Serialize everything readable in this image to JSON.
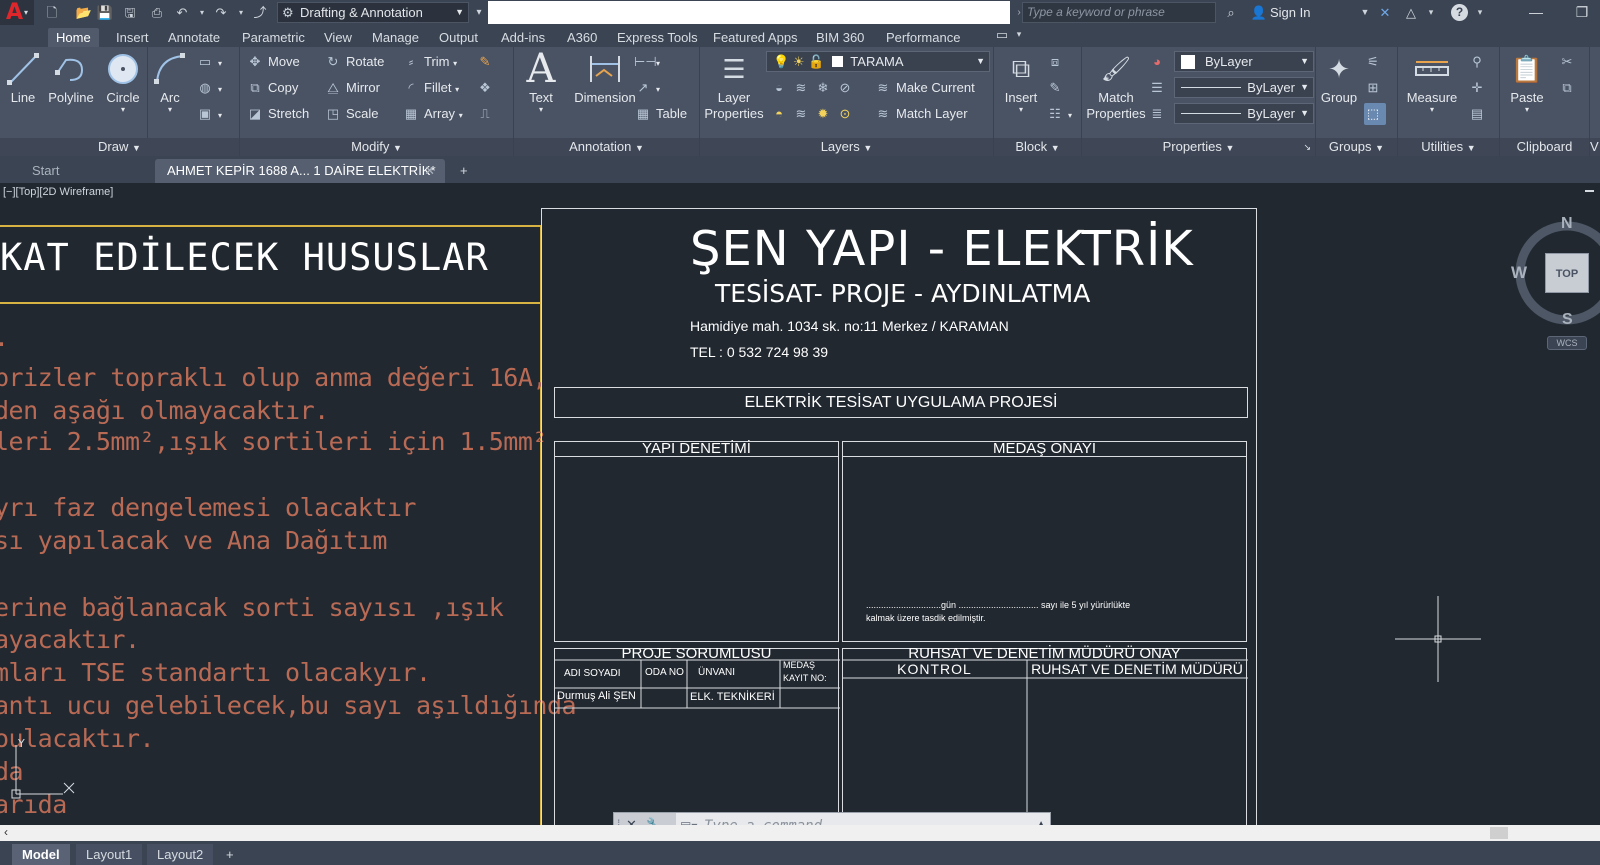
{
  "titlebar": {
    "workspace": "Drafting & Annotation",
    "search_placeholder": "Type a keyword or phrase",
    "sign_in": "Sign In"
  },
  "ribbon_tabs": [
    "Home",
    "Insert",
    "Annotate",
    "Parametric",
    "View",
    "Manage",
    "Output",
    "Add-ins",
    "A360",
    "Express Tools",
    "Featured Apps",
    "BIM 360",
    "Performance"
  ],
  "panels": {
    "draw": {
      "title": "Draw",
      "line": "Line",
      "polyline": "Polyline",
      "circle": "Circle",
      "arc": "Arc"
    },
    "modify": {
      "title": "Modify",
      "move": "Move",
      "rotate": "Rotate",
      "trim": "Trim",
      "copy": "Copy",
      "mirror": "Mirror",
      "fillet": "Fillet",
      "stretch": "Stretch",
      "scale": "Scale",
      "array": "Array"
    },
    "annotation": {
      "title": "Annotation",
      "text": "Text",
      "dimension": "Dimension",
      "table": "Table"
    },
    "layers": {
      "title": "Layers",
      "layer_properties": "Layer Properties",
      "current_layer": "TARAMA",
      "make_current": "Make Current",
      "match_layer": "Match Layer"
    },
    "block": {
      "title": "Block",
      "insert": "Insert"
    },
    "properties": {
      "title": "Properties",
      "match_properties": "Match Properties",
      "color": "ByLayer",
      "linetype": "ByLayer",
      "lineweight": "ByLayer"
    },
    "groups": {
      "title": "Groups",
      "group": "Group"
    },
    "utilities": {
      "title": "Utilities",
      "measure": "Measure"
    },
    "clipboard": {
      "title": "Clipboard",
      "paste": "Paste"
    },
    "view_partial": "V"
  },
  "doc_tabs": {
    "start": "Start",
    "active": "AHMET KEPİR 1688 A... 1 DAİRE ELEKTRİK*"
  },
  "viewport": {
    "label": "[−][Top][2D Wireframe]"
  },
  "drawing": {
    "left_heading": "KAT EDİLECEK HUSUSLAR",
    "left_lines": [
      ".",
      "prizler topraklı olup anma değeri 16A,",
      "den aşağı olmayacaktır.",
      "leri 2.5mm²,ışık sortileri için  1.5mm²",
      "yrı faz dengelemesi olacaktır",
      "sı yapılacak ve Ana Dağıtım",
      "erine bağlanacak sorti sayısı ,ışık",
      "ayacaktır.",
      "mları TSE standartı olacakyır.",
      "antı ucu gelebilecek,bu sayı aşıldığında",
      "oulacaktır.",
      "da",
      "arıda"
    ],
    "company_title": "ŞEN YAPI -   ELEKTRİK",
    "company_subtitle": "TESİSAT- PROJE - AYDINLATMA",
    "address": "Hamidiye mah. 1034 sk. no:11 Merkez / KARAMAN",
    "phone": "TEL : 0 532 724 98 39",
    "project_title": "ELEKTRİK TESİSAT UYGULAMA PROJESİ",
    "yapi_denetimi": "YAPI DENETİMİ",
    "medas_onayi": "MEDAŞ ONAYI",
    "medas_note_1": "..............................gün ................................ sayı ile 5 yıl yürürlükte",
    "medas_note_2": "kalmak üzere tasdik edilmiştir.",
    "proje_sorumlusu": "PROJE SORUMLUSU",
    "col_adi": "ADI SOYADI",
    "col_oda": "ODA NO",
    "col_unvani": "ÜNVANI",
    "col_medas_1": "MEDAŞ",
    "col_medas_2": "KAYIT NO:",
    "row_name": "Durmuş Ali ŞEN",
    "row_title": "ELK. TEKNİKERİ",
    "ruhsat_title": "RUHSAT VE DENETİM MÜDÜRÜ ONAY",
    "kontrol": "KONTROL",
    "ruhsat_mudur": "RUHSAT VE DENETİM MÜDÜRÜ"
  },
  "navcube": {
    "north": "N",
    "south": "S",
    "west": "W",
    "top": "TOP",
    "wcs": "WCS"
  },
  "command": {
    "placeholder": "Type a command"
  },
  "layout_tabs": [
    "Model",
    "Layout1",
    "Layout2"
  ]
}
